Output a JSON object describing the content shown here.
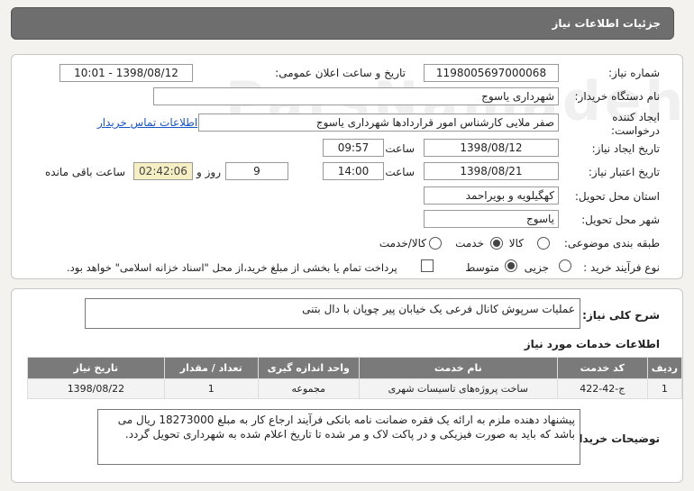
{
  "header": {
    "title": "جزئیات اطلاعات نیاز"
  },
  "details": {
    "need_number_label": "شماره نیاز:",
    "need_number": "1198005697000068",
    "announce_label": "تاریخ و ساعت اعلان عمومی:",
    "announce_value": "1398/08/12 - 10:01",
    "buyer_org_label": "نام دستگاه خریدار:",
    "buyer_org": "شهرداری یاسوج",
    "creator_label": "ایجاد کننده درخواست:",
    "creator": "صفر ملایی کارشناس امور قراردادها شهرداری یاسوج",
    "contact_link": "اطلاعات تماس خریدار",
    "created_date_label": "تاریخ ایجاد نیاز:",
    "created_date": "1398/08/12",
    "time_label": "ساعت",
    "created_time": "09:57",
    "validity_label": "تاریخ اعتبار نیاز:",
    "validity_date": "1398/08/21",
    "validity_time": "14:00",
    "days": "9",
    "days_label": "روز و",
    "remaining": "02:42:06",
    "remaining_label": "ساعت باقی مانده",
    "province_label": "استان محل تحویل:",
    "province": "کهگیلویه و بویراحمد",
    "city_label": "شهر محل تحویل:",
    "city": "یاسوج",
    "category_label": "طبقه بندی موضوعی:",
    "category_options": [
      "کالا",
      "خدمت",
      "کالا/خدمت"
    ],
    "process_label": "نوع فرآیند خرید :",
    "process_options": [
      "جزیی",
      "متوسط"
    ],
    "payment_text": "پرداخت تمام یا بخشی از مبلغ خرید،از محل \"اسناد خزانه اسلامی\" خواهد بود."
  },
  "summary": {
    "label": "شرح کلی نیاز:",
    "text": "عملیات سرپوش کانال فرعی یک خیابان پیر چوپان با دال بتنی",
    "services_title": "اطلاعات خدمات مورد نیاز",
    "columns": [
      "ردیف",
      "کد خدمت",
      "نام خدمت",
      "واحد اندازه گیری",
      "تعداد / مقدار",
      "تاریخ نیاز"
    ],
    "rows": [
      [
        "1",
        "ج-42-422",
        "ساخت پروژه‌های تاسیسات شهری",
        "مجموعه",
        "1",
        "1398/08/22"
      ]
    ],
    "buyer_notes_label": "توضیحات خریدار:",
    "buyer_notes": "پیشنهاد دهنده ملزم به ارائه یک فقره ضمانت نامه بانکی فرآیند ارجاع کار به مبلغ 18273000 ریال می باشد که باید به صورت فیزیکی و در پاکت لاک و مر شده تا تاریخ اعلام شده به شهرداری تحویل گردد."
  }
}
